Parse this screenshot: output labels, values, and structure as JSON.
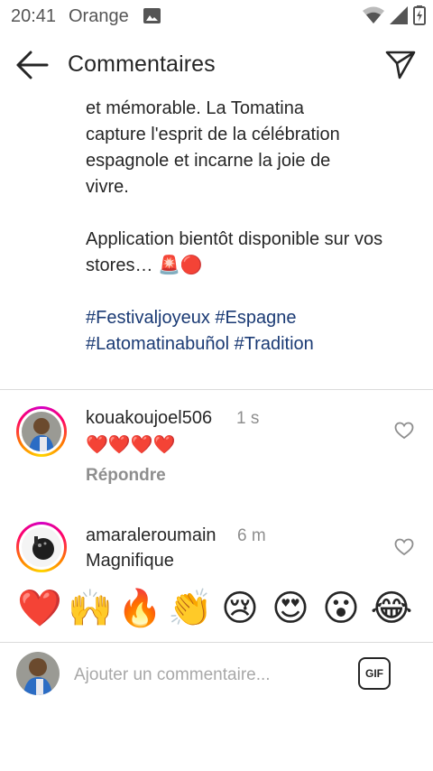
{
  "status_bar": {
    "time": "20:41",
    "carrier": "Orange",
    "icons": [
      "image-icon",
      "wifi-icon",
      "signal-icon",
      "battery-charging-icon"
    ]
  },
  "header": {
    "title": "Commentaires",
    "back_icon": "arrow-left-icon",
    "send_icon": "paper-plane-icon"
  },
  "caption": {
    "lines": [
      "et mémorable. La Tomatina",
      "capture l'esprit de la célébration",
      "espagnole et incarne la joie de",
      "vivre."
    ],
    "announcement": "Application bientôt disponible sur vos stores… 🚨🔴",
    "hashtags": [
      "#Festivaljoyeux",
      "#Espagne",
      "#Latomatinabuñol",
      "#Tradition"
    ]
  },
  "comments": [
    {
      "username": "kouakoujoel506",
      "time": "1 s",
      "text": "❤️❤️❤️❤️",
      "reply_label": "Répondre"
    },
    {
      "username": "amaraleroumain",
      "time": "6 m",
      "text": "Magnifique"
    }
  ],
  "emoji_bar": [
    "❤️",
    "🙌",
    "🔥",
    "👏",
    "😢",
    "😍",
    "😮",
    "😂"
  ],
  "composer": {
    "placeholder": "Ajouter un commentaire...",
    "gif_label": "GIF"
  },
  "colors": {
    "hashtag": "#1a3a74",
    "secondary_text": "#8e8e8e",
    "divider": "#dbdbdb"
  }
}
